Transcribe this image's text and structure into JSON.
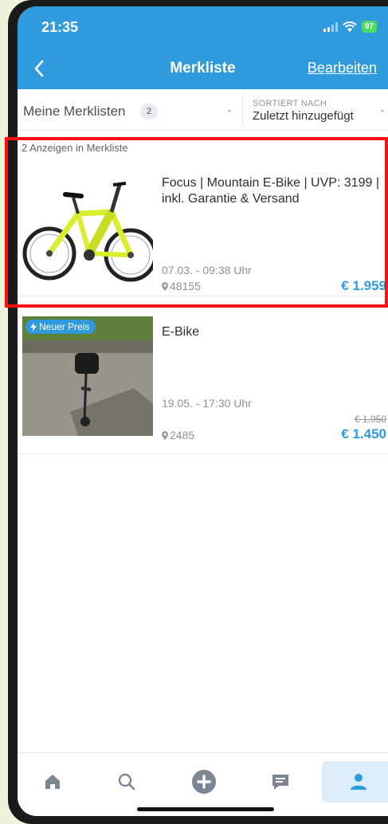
{
  "status_bar": {
    "time": "21:35",
    "battery": "97"
  },
  "header": {
    "title": "Merkliste",
    "edit_label": "Bearbeiten",
    "back_icon": "chevron-left-icon"
  },
  "subbar": {
    "lists_label": "Meine Merklisten",
    "lists_count": "2",
    "sort_caption": "SORTIERT NACH",
    "sort_value": "Zuletzt hinzugefügt"
  },
  "count_line": "2 Anzeigen in Merkliste",
  "items": [
    {
      "title": "Focus | Mountain E-Bike | UVP: 3199 | inkl. Garantie & Versand",
      "date": "07.03. - 09:38 Uhr",
      "location": "48155",
      "price": "€ 1.959"
    },
    {
      "badge": "Neuer Preis",
      "title": "E-Bike",
      "date": "19.05. - 17:30 Uhr",
      "location": "2485",
      "old_price": "€ 1.950",
      "price": "€ 1.450"
    }
  ],
  "colors": {
    "accent": "#2f9bdd",
    "highlight": "#ff1010"
  },
  "bottom_nav": [
    "home-icon",
    "search-icon",
    "add-icon",
    "messages-icon",
    "profile-icon"
  ]
}
